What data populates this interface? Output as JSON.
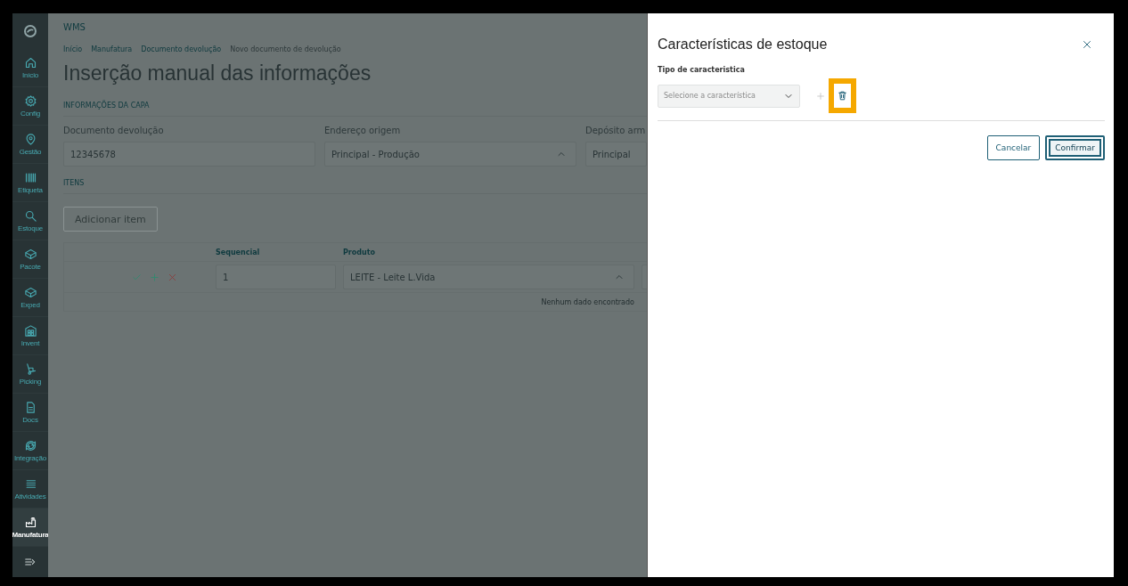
{
  "app": {
    "name": "WMS"
  },
  "sidebar": {
    "items": [
      {
        "label": "Início",
        "selected": false
      },
      {
        "label": "Config",
        "selected": false
      },
      {
        "label": "Gestão",
        "selected": false
      },
      {
        "label": "Etiqueta",
        "selected": false
      },
      {
        "label": "Estoque",
        "selected": false
      },
      {
        "label": "Pacote",
        "selected": false
      },
      {
        "label": "Exped",
        "selected": false
      },
      {
        "label": "Invent",
        "selected": false
      },
      {
        "label": "Picking",
        "selected": false
      },
      {
        "label": "Docs",
        "selected": false
      },
      {
        "label": "Integração",
        "selected": false
      },
      {
        "label": "Atividades",
        "selected": false
      },
      {
        "label": "Manufatura",
        "selected": true
      }
    ]
  },
  "breadcrumb": [
    "Início",
    "Manufatura",
    "Documento devolução",
    "Novo documento de devolução"
  ],
  "page_title": "Inserção manual das informações",
  "header_section": {
    "title": "INFORMAÇÕES DA CAPA",
    "fields": [
      {
        "label": "Documento devolução",
        "value": "12345678",
        "kind": "text"
      },
      {
        "label": "Endereço origem",
        "value": "Principal - Produção",
        "kind": "select"
      },
      {
        "label": "Depósito arm",
        "value": "Principal",
        "kind": "text"
      }
    ]
  },
  "items_section": {
    "title": "ITENS",
    "add_button": "Adicionar item",
    "add_button_disabled": true,
    "table": {
      "columns": [
        "Sequencial",
        "Produto"
      ],
      "rows": [
        {
          "sequencial": "1",
          "produto": "LEITE - Leite L.Vida"
        }
      ],
      "empty_message": "Nenhum dado encontrado"
    }
  },
  "drawer": {
    "title": "Características de estoque",
    "field_label": "Tipo de caracteristica",
    "select_placeholder": "Selecione a característica",
    "delete_highlighted": true,
    "buttons": [
      {
        "label": "Cancelar",
        "focused": false
      },
      {
        "label": "Confirmar",
        "focused": true
      }
    ]
  }
}
